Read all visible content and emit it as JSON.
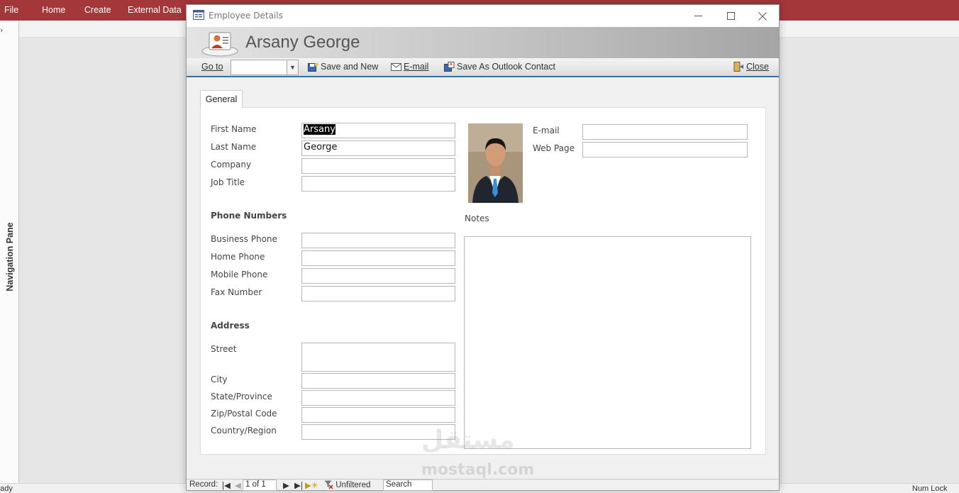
{
  "ribbon": {
    "tabs": [
      "File",
      "Home",
      "Create",
      "External Data"
    ]
  },
  "nav_pane": {
    "label": "Navigation Pane",
    "chevron": "›"
  },
  "status": {
    "left": "eady",
    "right": "Num Lock"
  },
  "dialog": {
    "title": "Employee Details",
    "header_name": "Arsany George",
    "toolbar": {
      "goto": "Go to",
      "save_new": "Save and New",
      "email": "E-mail",
      "save_outlook": "Save As Outlook Contact",
      "close": "Close"
    },
    "tab_label": "General",
    "fields": {
      "first_name": {
        "label": "First Name",
        "value": "Arsany"
      },
      "last_name": {
        "label": "Last Name",
        "value": "George"
      },
      "company": {
        "label": "Company",
        "value": ""
      },
      "job_title": {
        "label": "Job Title",
        "value": ""
      },
      "email": {
        "label": "E-mail",
        "value": ""
      },
      "web_page": {
        "label": "Web Page",
        "value": ""
      }
    },
    "phone_section": "Phone Numbers",
    "phones": {
      "business": {
        "label": "Business Phone",
        "value": ""
      },
      "home": {
        "label": "Home Phone",
        "value": ""
      },
      "mobile": {
        "label": "Mobile Phone",
        "value": ""
      },
      "fax": {
        "label": "Fax Number",
        "value": ""
      }
    },
    "address_section": "Address",
    "address": {
      "street": {
        "label": "Street",
        "value": ""
      },
      "city": {
        "label": "City",
        "value": ""
      },
      "state": {
        "label": "State/Province",
        "value": ""
      },
      "zip": {
        "label": "Zip/Postal Code",
        "value": ""
      },
      "country": {
        "label": "Country/Region",
        "value": ""
      }
    },
    "notes_label": "Notes",
    "record_nav": {
      "record_label": "Record:",
      "position": "1 of 1",
      "filter": "Unfiltered",
      "search": "Search"
    }
  },
  "watermark": {
    "arabic": "مستقل",
    "latin": "mostaql.com"
  },
  "colors": {
    "ribbon": "#a4373a",
    "toolbar_accent": "#3f6da3"
  }
}
